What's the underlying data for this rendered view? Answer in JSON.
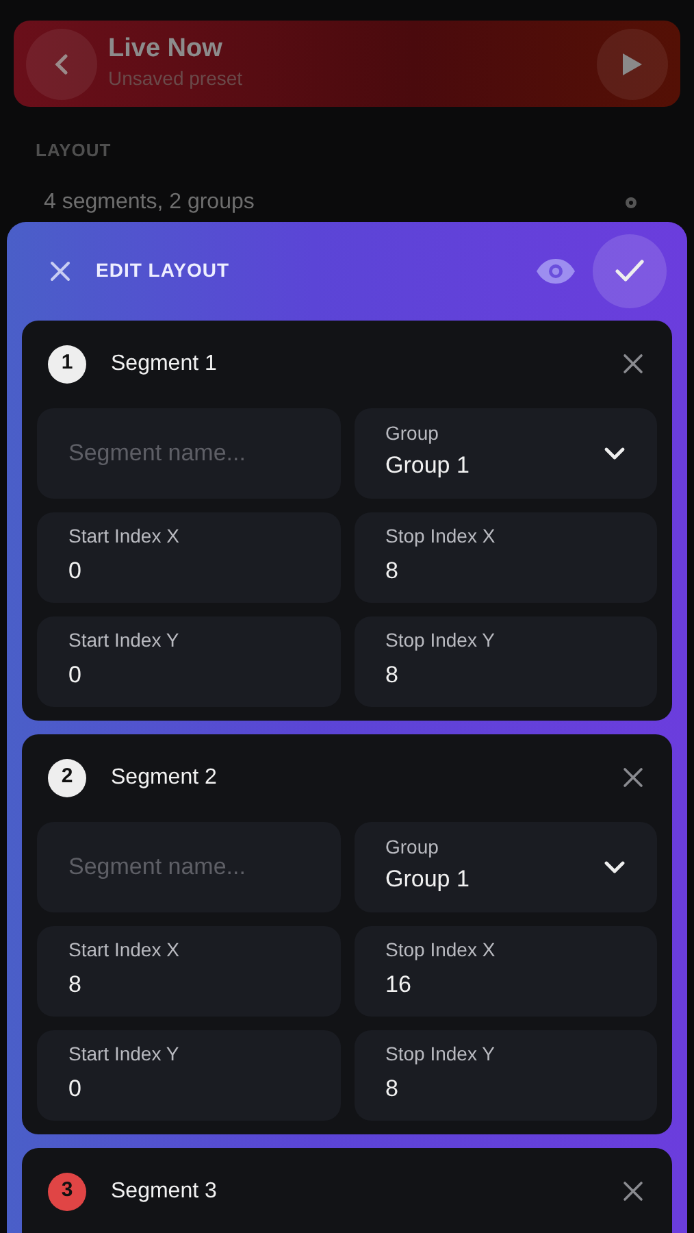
{
  "now_playing": {
    "title": "Live Now",
    "subtitle": "Unsaved preset"
  },
  "section_label": "LAYOUT",
  "layout_summary": "4 segments, 2 groups",
  "editor": {
    "title": "EDIT LAYOUT",
    "segments": [
      {
        "number": "1",
        "color": "#eeeeee",
        "title": "Segment 1",
        "name_placeholder": "Segment name...",
        "group_label": "Group",
        "group_value": "Group 1",
        "fields": [
          {
            "label": "Start Index X",
            "value": "0"
          },
          {
            "label": "Stop Index X",
            "value": "8"
          },
          {
            "label": "Start Index Y",
            "value": "0"
          },
          {
            "label": "Stop Index Y",
            "value": "8"
          }
        ]
      },
      {
        "number": "2",
        "color": "#eeeeee",
        "title": "Segment 2",
        "name_placeholder": "Segment name...",
        "group_label": "Group",
        "group_value": "Group 1",
        "fields": [
          {
            "label": "Start Index X",
            "value": "8"
          },
          {
            "label": "Stop Index X",
            "value": "16"
          },
          {
            "label": "Start Index Y",
            "value": "0"
          },
          {
            "label": "Stop Index Y",
            "value": "8"
          }
        ]
      },
      {
        "number": "3",
        "color": "#e04545",
        "title": "Segment 3"
      }
    ]
  }
}
